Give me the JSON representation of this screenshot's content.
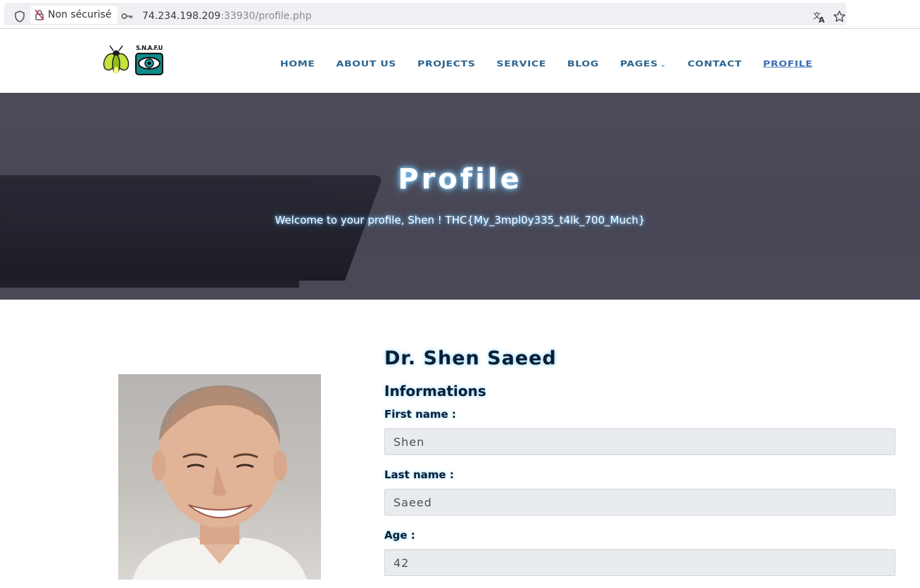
{
  "browser": {
    "security_label": "Non sécurisé",
    "url_host": "74.234.198.209",
    "url_rest": ":33930/profile.php"
  },
  "site": {
    "logo_text": "S.N.A.F.U",
    "nav": {
      "home": "HOME",
      "about": "ABOUT US",
      "projects": "PROJECTS",
      "service": "SERVICE",
      "blog": "BLOG",
      "pages": "PAGES",
      "contact": "CONTACT",
      "profile": "PROFILE"
    }
  },
  "hero": {
    "title": "Profile",
    "subtitle": "Welcome to your profile, Shen ! THC{My_3mpl0y335_t4lk_700_Much}"
  },
  "profile": {
    "name": "Dr. Shen Saeed",
    "section_title": "Informations",
    "first_name_label": "First name :",
    "first_name": "Shen",
    "last_name_label": "Last name :",
    "last_name": "Saeed",
    "age_label": "Age :",
    "age": "42"
  },
  "colors": {
    "nav": "#2a6591",
    "nav_active": "#3b6fb6",
    "hero_bg": "#4a4857",
    "glow": "#7fd0ff",
    "field_bg": "#e9ecef"
  }
}
